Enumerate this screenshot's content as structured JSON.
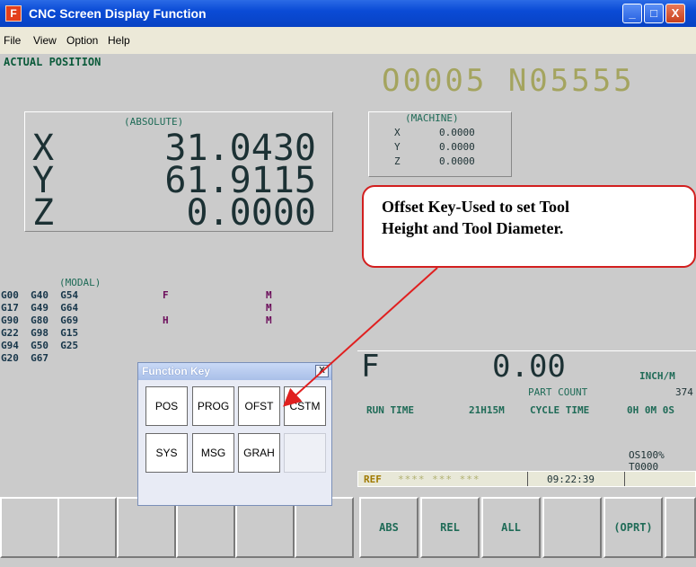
{
  "window": {
    "icon": "F",
    "title": "CNC Screen Display Function",
    "buttons": [
      "_",
      "□",
      "X"
    ]
  },
  "menu": [
    "File",
    "View",
    "Option",
    "Help"
  ],
  "screen": {
    "title": "ACTUAL POSITION",
    "program": "O0005 N05555",
    "absolute": {
      "label": "(ABSOLUTE)",
      "axes": [
        {
          "axis": "X",
          "value": "31.0430"
        },
        {
          "axis": "Y",
          "value": "61.9115"
        },
        {
          "axis": "Z",
          "value": "0.0000"
        }
      ]
    },
    "machine": {
      "label": "(MACHINE)",
      "axes": [
        {
          "axis": "X",
          "value": "0.0000"
        },
        {
          "axis": "Y",
          "value": "0.0000"
        },
        {
          "axis": "Z",
          "value": "0.0000"
        }
      ]
    },
    "modal": {
      "label": "(MODAL)",
      "rows": [
        "G00  G40  G54",
        "G17  G49  G64",
        "G90  G80  G69",
        "G22  G98  G15",
        "G94  G50  G25",
        "G20  G67"
      ],
      "f_label": "F",
      "m_labels": [
        "M",
        "M",
        "M"
      ],
      "h_label": "H"
    },
    "feed": {
      "letter": "F",
      "value": "0.00",
      "unit": "INCH/M"
    },
    "part_count": {
      "label": "PART COUNT",
      "value": "374"
    },
    "run_time": {
      "label": "RUN TIME",
      "value": "21H15M"
    },
    "cycle_time": {
      "label": "CYCLE TIME",
      "value": "0H 0M 0S"
    },
    "override": "OS100% T0000",
    "status": {
      "mode": "REF",
      "stars": "**** *** ***",
      "clock": "09:22:39"
    },
    "softkeys": [
      "ABS",
      "REL",
      "ALL",
      "",
      "(OPRT)",
      ""
    ]
  },
  "function_key": {
    "title": "Function Key",
    "close": "X",
    "keys": [
      "POS",
      "PROG",
      "OFST",
      "CSTM",
      "SYS",
      "MSG",
      "GRAH",
      ""
    ]
  },
  "callout": {
    "line1": "Offset Key-Used to set Tool",
    "line2": "Height and Tool Diameter."
  },
  "colors": {
    "screen_bg": "#cbcbcb",
    "program_number": "#a4a45f",
    "callout_border": "#d21f1f",
    "title_bar": "#0a4bd6"
  }
}
